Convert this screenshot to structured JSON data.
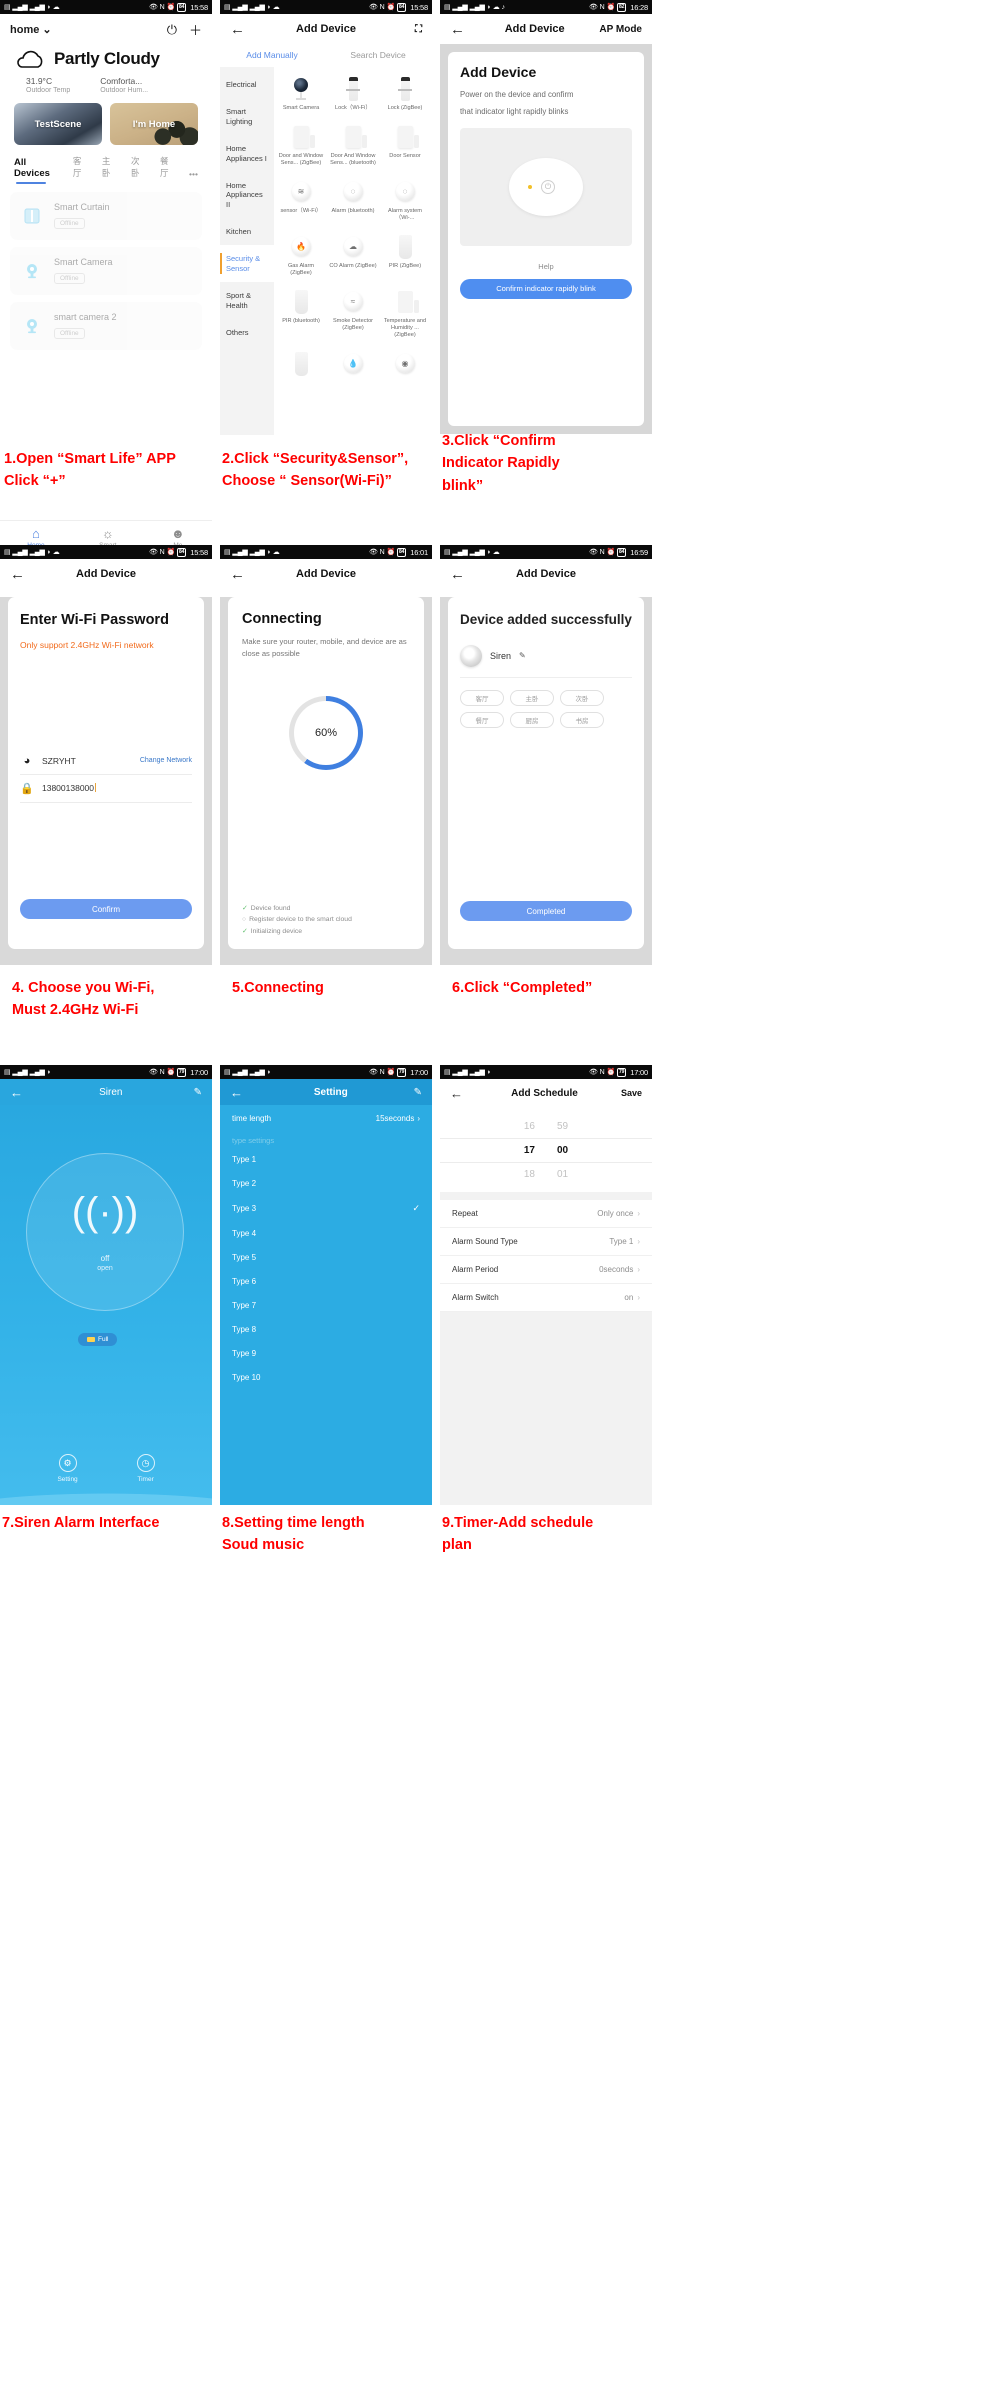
{
  "panels": {
    "p1": {
      "status": {
        "time": "15:58",
        "battery": "84"
      },
      "home_name": "home",
      "mic_icon": "microphone-icon",
      "add_icon": "plus-icon",
      "weather": {
        "condition": "Partly Cloudy",
        "temp_value": "31.9°C",
        "temp_label": "Outdoor Temp",
        "hum_value": "Comforta...",
        "hum_label": "Outdoor Hum..."
      },
      "scenes": [
        {
          "label": "TestScene"
        },
        {
          "label": "I'm Home"
        }
      ],
      "tabs": [
        "All Devices",
        "客厅",
        "主卧",
        "次卧",
        "餐厅",
        "•••"
      ],
      "devices": [
        {
          "name": "Smart Curtain",
          "status": "Offline",
          "icon": "curtain-icon"
        },
        {
          "name": "Smart  Camera",
          "status": "Offline",
          "icon": "camera-icon"
        },
        {
          "name": "smart camera 2",
          "status": "Offline",
          "icon": "camera-icon"
        }
      ],
      "nav": [
        {
          "label": "Home",
          "icon": "home-icon"
        },
        {
          "label": "Smart",
          "icon": "sun-icon"
        },
        {
          "label": "Me",
          "icon": "person-icon"
        }
      ]
    },
    "p2": {
      "status": {
        "time": "15:58",
        "battery": "84"
      },
      "title": "Add Device",
      "scan_icon": "scan-icon",
      "segments": [
        "Add Manually",
        "Search Device"
      ],
      "categories": [
        "Electrical",
        "Smart Lighting",
        "Home Appliances I",
        "Home Appliances II",
        "Kitchen",
        "Security & Sensor",
        "Sport & Health",
        "Others"
      ],
      "active_category": "Security & Sensor",
      "devices": [
        {
          "label": "Smart Camera",
          "icon": "camera-device-icon"
        },
        {
          "label": "Lock（Wi-Fi）",
          "icon": "lock-device-icon"
        },
        {
          "label": "Lock (ZigBee)",
          "icon": "lock-device-icon"
        },
        {
          "label": "Door and Window Sens... (ZigBee)",
          "icon": "door-sensor-icon"
        },
        {
          "label": "Door And Window Sens... (bluetooth)",
          "icon": "door-sensor-icon"
        },
        {
          "label": "Door Sensor",
          "icon": "door-sensor-icon"
        },
        {
          "label": "sensor（Wi-Fi）",
          "icon": "motion-sensor-icon"
        },
        {
          "label": "Alarm (bluetooth)",
          "icon": "alarm-icon"
        },
        {
          "label": "Alarm system（Wi-...",
          "icon": "alarm-icon"
        },
        {
          "label": "Gas Alarm (ZigBee)",
          "icon": "gas-alarm-icon"
        },
        {
          "label": "CO Alarm (ZigBee)",
          "icon": "co-alarm-icon"
        },
        {
          "label": "PIR (ZigBee)",
          "icon": "pir-icon"
        },
        {
          "label": "PIR (bluetooth)",
          "icon": "pir-icon"
        },
        {
          "label": "Smoke Detector (ZigBee)",
          "icon": "smoke-icon"
        },
        {
          "label": "Temperature and Humidity ... (ZigBee)",
          "icon": "temp-humidity-icon"
        },
        {
          "label": "",
          "icon": "device-icon"
        },
        {
          "label": "",
          "icon": "water-icon"
        },
        {
          "label": "",
          "icon": "sensor-icon"
        }
      ]
    },
    "p3": {
      "status": {
        "time": "16:28",
        "battery": "82"
      },
      "title": "Add Device",
      "mode": "AP Mode",
      "heading": "Add Device",
      "line1": "Power on the device and confirm",
      "line2": "that indicator light rapidly blinks",
      "help": "Help",
      "button": "Confirm indicator rapidly blink"
    },
    "p4": {
      "status": {
        "time": "15:58",
        "battery": "84"
      },
      "title": "Add Device",
      "heading": "Enter Wi-Fi Password",
      "warning": "Only support 2.4GHz Wi-Fi network",
      "ssid": "SZRYHT",
      "change_network": "Change Network",
      "password": "13800138000",
      "button": "Confirm",
      "wifi_icon": "wifi-icon",
      "lock_icon": "lock-icon"
    },
    "p5": {
      "status": {
        "time": "16:01",
        "battery": "84"
      },
      "title": "Add Device",
      "heading": "Connecting",
      "subtitle": "Make sure your router, mobile, and device are as close as possible",
      "progress": "60%",
      "progress_value": 60,
      "steps": [
        {
          "text": "Device found",
          "done": true
        },
        {
          "text": "Register device to the smart cloud",
          "done": false
        },
        {
          "text": "Initializing device",
          "done": true
        }
      ]
    },
    "p6": {
      "status": {
        "time": "16:59",
        "battery": "84"
      },
      "title": "Add Device",
      "heading": "Device added successfully",
      "device_name": "Siren",
      "edit_icon": "pencil-icon",
      "rooms": [
        "客厅",
        "主卧",
        "次卧",
        "餐厅",
        "厨房",
        "书房"
      ],
      "button": "Completed"
    },
    "p7": {
      "status": {
        "time": "17:00",
        "battery": "79"
      },
      "title": "Siren",
      "edit_icon": "pencil-icon",
      "state": "off",
      "sub_state": "open",
      "battery_pill": "Full",
      "buttons": [
        {
          "label": "Setting",
          "icon": "gear-icon"
        },
        {
          "label": "Timer",
          "icon": "clock-icon"
        }
      ]
    },
    "p8": {
      "status": {
        "time": "17:00",
        "battery": "79"
      },
      "title": "Setting",
      "edit_icon": "pencil-icon",
      "time_length_label": "time length",
      "time_length_value": "15seconds",
      "type_settings_label": "type settings",
      "types": [
        {
          "label": "Type 1",
          "selected": false
        },
        {
          "label": "Type 2",
          "selected": false
        },
        {
          "label": "Type 3",
          "selected": true
        },
        {
          "label": "Type 4",
          "selected": false
        },
        {
          "label": "Type 5",
          "selected": false
        },
        {
          "label": "Type 6",
          "selected": false
        },
        {
          "label": "Type 7",
          "selected": false
        },
        {
          "label": "Type 8",
          "selected": false
        },
        {
          "label": "Type 9",
          "selected": false
        },
        {
          "label": "Type 10",
          "selected": false
        }
      ]
    },
    "p9": {
      "status": {
        "time": "17:00",
        "battery": "79"
      },
      "title": "Add Schedule",
      "save": "Save",
      "time_picker": {
        "prev": {
          "hour": "16",
          "minute": "59"
        },
        "selected": {
          "hour": "17",
          "minute": "00"
        },
        "next": {
          "hour": "18",
          "minute": "01"
        }
      },
      "rows": [
        {
          "key": "Repeat",
          "value": "Only once"
        },
        {
          "key": "Alarm Sound Type",
          "value": "Type 1"
        },
        {
          "key": "Alarm Period",
          "value": "0seconds"
        },
        {
          "key": "Alarm Switch",
          "value": "on"
        }
      ]
    }
  },
  "captions": {
    "c1": "1.Open “Smart Life” APP\nClick “+”",
    "c2": "2.Click “Security&Sensor”,\nChoose “ Sensor(Wi-Fi)”",
    "c3": "3.Click “Confirm\nIndicator Rapidly\nblink”",
    "c4": "4. Choose you Wi-Fi,\nMust 2.4GHz Wi-Fi",
    "c5": "5.Connecting",
    "c6": "6.Click “Completed”",
    "c7": "7.Siren Alarm Interface",
    "c8": "8.Setting time length\nSoud music",
    "c9": "9.Timer-Add schedule\nplan"
  }
}
